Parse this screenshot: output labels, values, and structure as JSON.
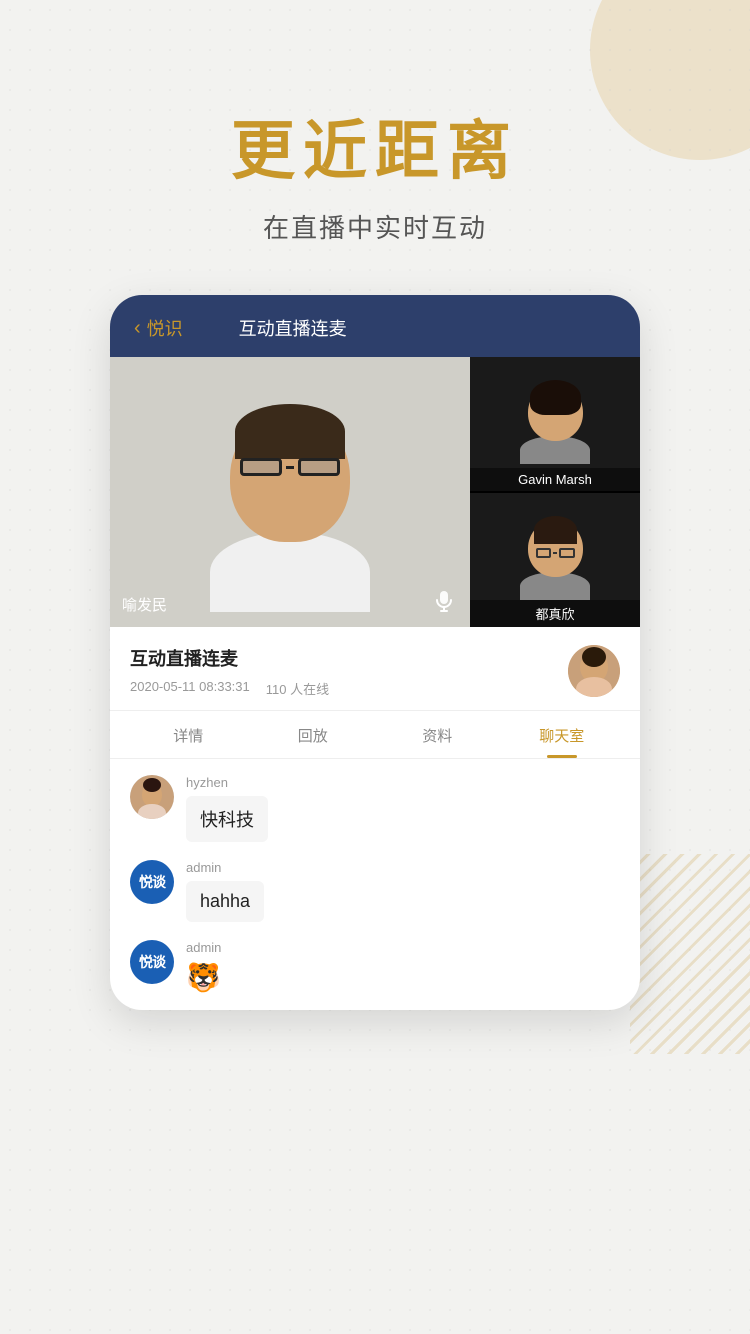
{
  "background": {
    "color": "#f2f2f0"
  },
  "hero": {
    "title": "更近距离",
    "subtitle": "在直播中实时互动"
  },
  "app": {
    "header": {
      "back_icon": "‹",
      "back_label": "悦识",
      "title": "互动直播连麦"
    },
    "video": {
      "main_speaker": {
        "name": "喻发民",
        "has_mic": true
      },
      "panel1": {
        "name": "Gavin Marsh"
      },
      "panel2": {
        "name": "都真欣"
      }
    },
    "info": {
      "title": "互动直播连麦",
      "date": "2020-05-11 08:33:31",
      "viewers": "110 人在线"
    },
    "tabs": [
      {
        "id": "details",
        "label": "详情",
        "active": false
      },
      {
        "id": "replay",
        "label": "回放",
        "active": false
      },
      {
        "id": "materials",
        "label": "资料",
        "active": false
      },
      {
        "id": "chat",
        "label": "聊天室",
        "active": true
      }
    ],
    "chat": {
      "messages": [
        {
          "id": 1,
          "avatar_type": "photo",
          "username": "hyzhen",
          "content": "快科技",
          "content_type": "text"
        },
        {
          "id": 2,
          "avatar_type": "logo",
          "username": "admin",
          "content": "hahha",
          "content_type": "text"
        },
        {
          "id": 3,
          "avatar_type": "logo",
          "username": "admin",
          "content": "🐯",
          "content_type": "emoji"
        }
      ]
    }
  }
}
